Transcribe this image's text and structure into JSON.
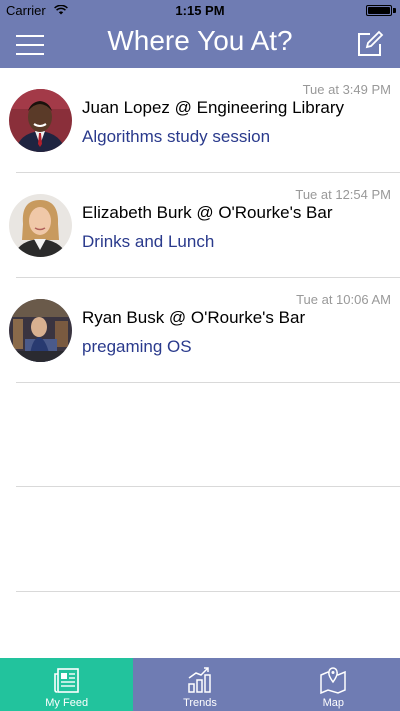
{
  "status_bar": {
    "carrier": "Carrier",
    "time": "1:15 PM"
  },
  "navbar": {
    "title": "Where You At?"
  },
  "colors": {
    "header": "#6f7cb3",
    "active_tab": "#22c39d",
    "message": "#2a3a8c",
    "timestamp": "#999999"
  },
  "feed": [
    {
      "time": "Tue at 3:49 PM",
      "name": "Juan Lopez",
      "location": "Engineering Library",
      "title": "Juan Lopez @ Engineering Library",
      "message": "Algorithms study session"
    },
    {
      "time": "Tue at 12:54 PM",
      "name": "Elizabeth Burk",
      "location": "O'Rourke's Bar",
      "title": "Elizabeth Burk @ O'Rourke's Bar",
      "message": "Drinks and Lunch"
    },
    {
      "time": "Tue at 10:06 AM",
      "name": "Ryan Busk",
      "location": "O'Rourke's Bar",
      "title": "Ryan Busk @ O'Rourke's Bar",
      "message": "pregaming OS"
    }
  ],
  "tabs": [
    {
      "label": "My Feed",
      "icon": "newspaper-icon",
      "active": true
    },
    {
      "label": "Trends",
      "icon": "bar-chart-icon",
      "active": false
    },
    {
      "label": "Map",
      "icon": "map-pin-icon",
      "active": false
    }
  ]
}
